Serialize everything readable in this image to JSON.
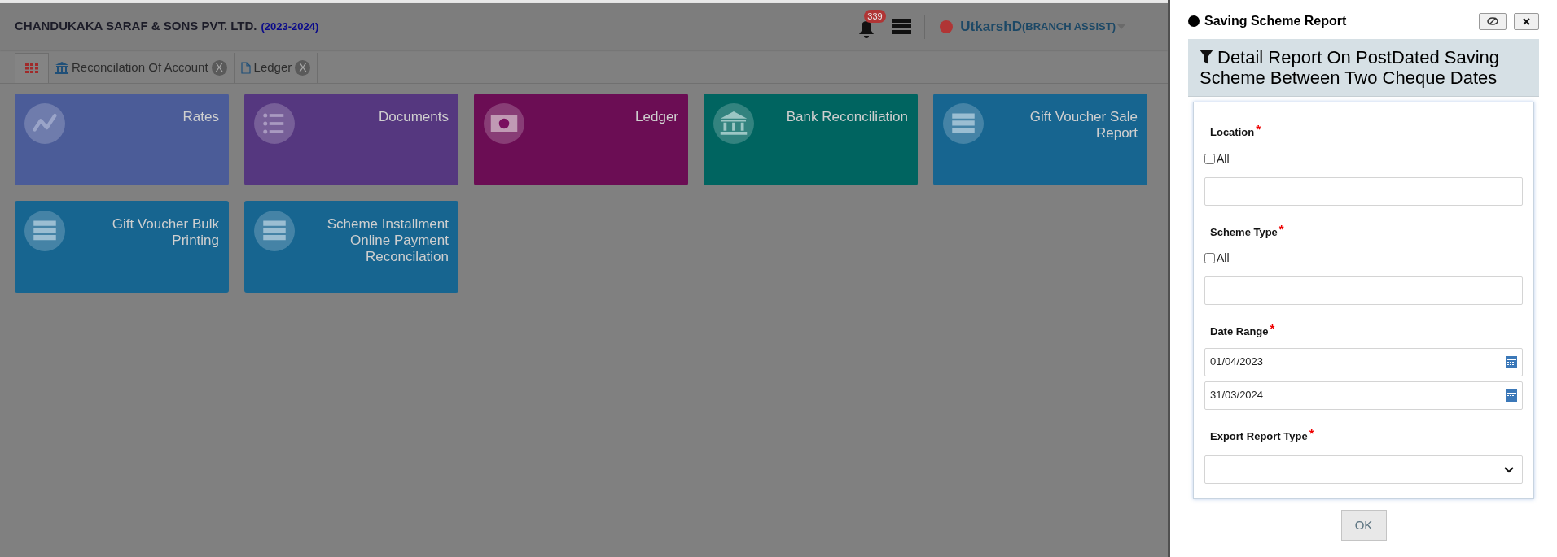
{
  "header": {
    "company": "CHANDUKAKA SARAF & SONS PVT. LTD.",
    "year": "(2023-2024)",
    "notification_count": "339",
    "user": "UtkarshD",
    "role": "(BRANCH ASSIST)"
  },
  "tabs": [
    {
      "kind": "home",
      "selected": true
    },
    {
      "kind": "bank",
      "label": "Reconcilation Of Account",
      "close": "X",
      "selected": false
    },
    {
      "kind": "document",
      "label": "Ledger",
      "close": "X",
      "selected": false
    }
  ],
  "tiles": [
    {
      "kind": "chart",
      "title": "Rates",
      "color": "#4b5c98"
    },
    {
      "kind": "list",
      "title": "Documents",
      "color": "#55377f"
    },
    {
      "kind": "money",
      "title": "Ledger",
      "color": "#6b0d54"
    },
    {
      "kind": "bank",
      "title": "Bank Reconciliation",
      "color": "#006460"
    },
    {
      "kind": "server",
      "title": "Gift Voucher Sale Report",
      "color": "#176590"
    },
    {
      "kind": "server",
      "title": "Gift Voucher Bulk Printing",
      "color": "#176590"
    },
    {
      "kind": "server",
      "title": "Scheme Installment Online Payment Reconcilation",
      "color": "#176590"
    }
  ],
  "panel": {
    "title": "Saving Scheme Report",
    "heading": "Detail Report On PostDated Saving Scheme Between Two Cheque Dates",
    "fields": [
      {
        "kind": "multi",
        "label": "Location",
        "required_mark": "*",
        "all": {
          "label": "All",
          "checked": false
        }
      },
      {
        "kind": "multi",
        "label": "Scheme Type",
        "required_mark": "*",
        "all": {
          "label": "All",
          "checked": false
        }
      },
      {
        "kind": "dates",
        "label": "Date Range",
        "required_mark": "*",
        "values": [
          "01/04/2023",
          "31/03/2024"
        ]
      },
      {
        "kind": "select",
        "label": "Export Report Type",
        "required_mark": "*"
      }
    ],
    "ok": {
      "label": "OK",
      "disabled": true
    }
  }
}
